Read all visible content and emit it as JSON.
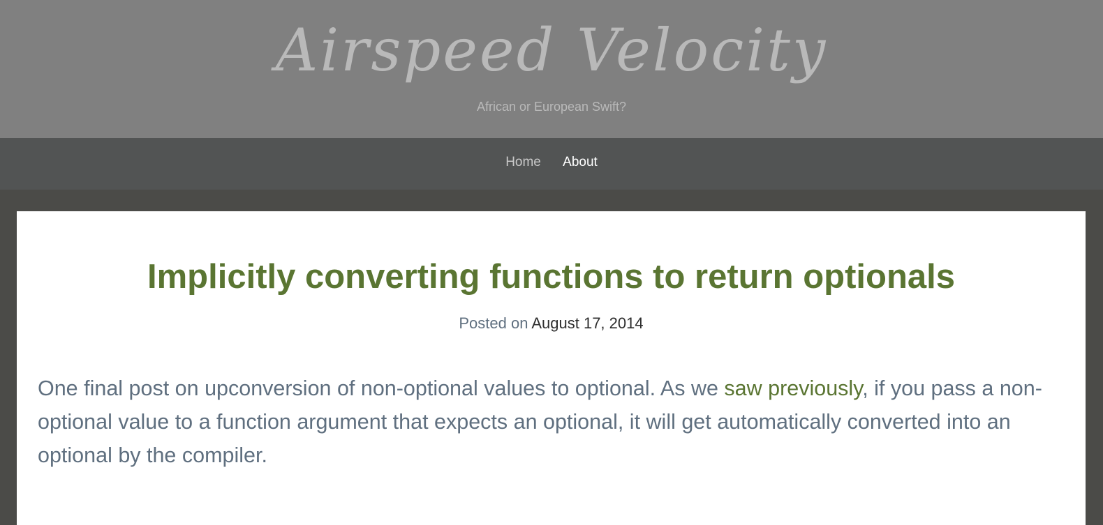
{
  "site": {
    "title": "Airspeed Velocity",
    "tagline": "African or European Swift?"
  },
  "nav": {
    "items": [
      {
        "label": "Home"
      },
      {
        "label": "About"
      }
    ]
  },
  "post": {
    "title": "Implicitly converting functions to return optionals",
    "meta_prefix": "Posted on",
    "date": "August 17, 2014",
    "paragraph": {
      "text_before_link": "One final post on upconversion of non-optional values to optional. As we ",
      "link_text": "saw previously",
      "text_after_link": ", if you pass a non-optional value to a function argument that expects an optional, it will get automatically converted into an optional by the compiler."
    }
  },
  "colors": {
    "header_bg": "#808080",
    "nav_bg": "#525454",
    "page_bg": "#4b4b48",
    "accent_green": "#5a7532",
    "body_text": "#5f6f7f"
  }
}
